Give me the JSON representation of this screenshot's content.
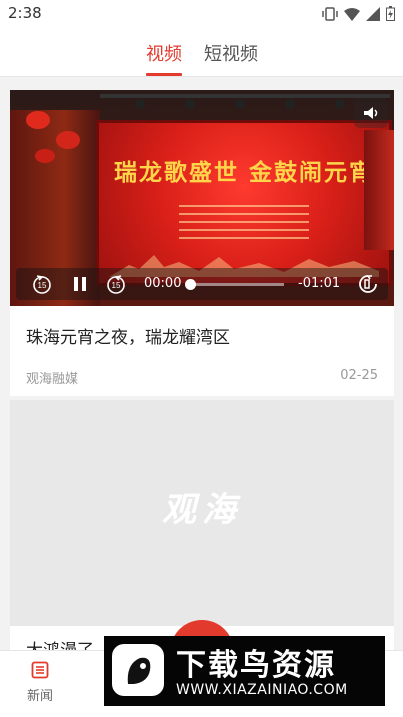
{
  "status_bar": {
    "time": "2:38"
  },
  "tabs": [
    {
      "label": "视频",
      "active": true
    },
    {
      "label": "短视频",
      "active": false
    }
  ],
  "colors": {
    "accent": "#e23b2e",
    "muted": "#999999",
    "background": "#f2f2f2"
  },
  "video_card": {
    "stage_title": "瑞龙歌盛世 金鼓闹元宵",
    "player": {
      "current_time": "00:00",
      "remaining_time": "-01:01",
      "progress": 0.0,
      "buttons": [
        "rewind-15-icon",
        "pause-icon",
        "forward-15-icon",
        "volume-icon",
        "rotate-icon"
      ]
    },
    "title": "珠海元宵之夜，瑞龙耀湾区",
    "source": "观海融媒",
    "date": "02-25"
  },
  "placeholder_card": {
    "logo_text": "观海"
  },
  "next_card": {
    "title": "大鸿漫了"
  },
  "bottom_nav": {
    "news_label": "新闻"
  },
  "watermark": {
    "brand": "下载鸟资源",
    "url": "WWW.XIAZAINIAO.COM"
  }
}
